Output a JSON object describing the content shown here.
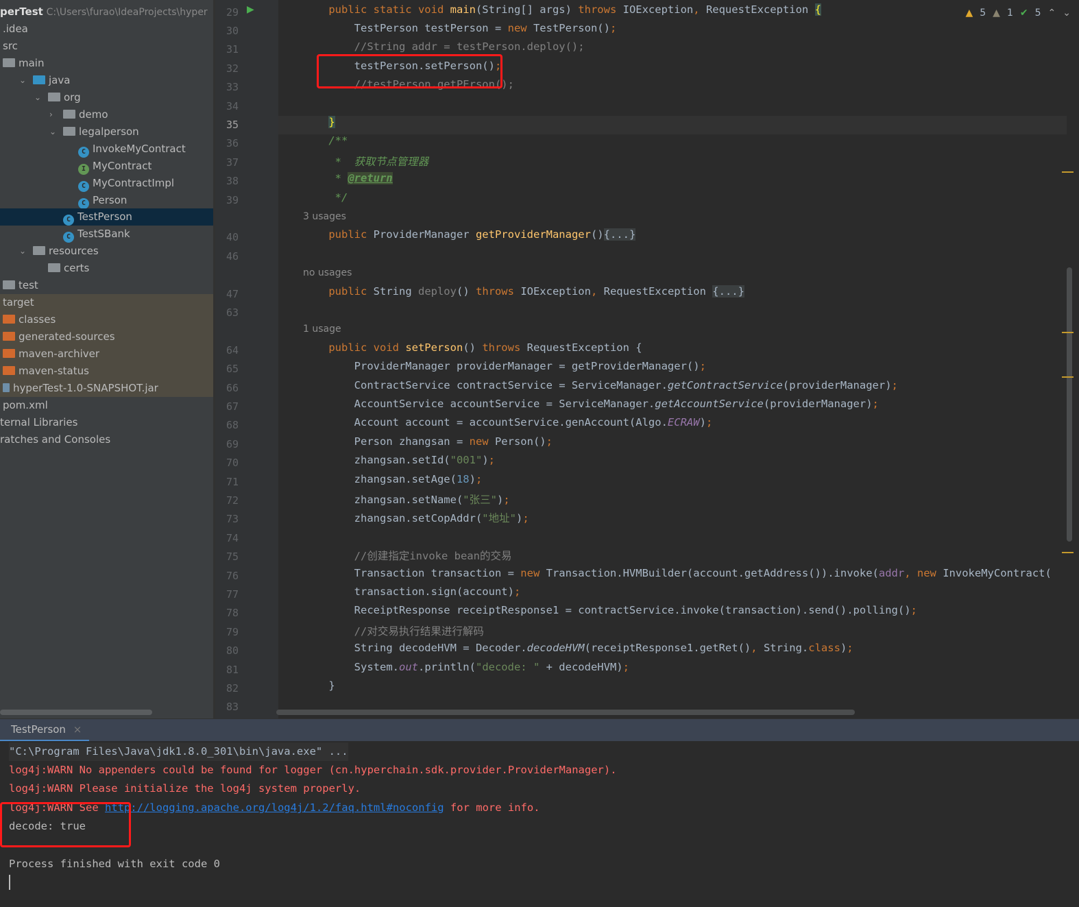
{
  "colors": {
    "keyword": "#cc7832",
    "method": "#ffc66d",
    "comment": "#808080",
    "doc": "#629755",
    "string": "#6a8759",
    "number": "#6897bb",
    "static": "#9876aa",
    "error": "#ff6b68",
    "link": "#287bde",
    "highlight_box": "#ff1a1a"
  },
  "sidebar": {
    "project_name": "perTest",
    "project_path": "C:\\Users\\furao\\IdeaProjects\\hyper",
    "items": [
      {
        "label": ".idea",
        "indent": 0,
        "icon": "none"
      },
      {
        "label": "src",
        "indent": 0,
        "icon": "none"
      },
      {
        "label": "main",
        "indent": 0,
        "icon": "folder"
      },
      {
        "label": "java",
        "indent": 1,
        "icon": "source-folder",
        "expanded": true
      },
      {
        "label": "org",
        "indent": 2,
        "icon": "package",
        "expanded": true
      },
      {
        "label": "demo",
        "indent": 3,
        "icon": "package",
        "expanded": false
      },
      {
        "label": "legalperson",
        "indent": 3,
        "icon": "package",
        "expanded": true
      },
      {
        "label": "InvokeMyContract",
        "indent": 4,
        "icon": "class"
      },
      {
        "label": "MyContract",
        "indent": 4,
        "icon": "interface"
      },
      {
        "label": "MyContractImpl",
        "indent": 4,
        "icon": "class"
      },
      {
        "label": "Person",
        "indent": 4,
        "icon": "class"
      },
      {
        "label": "TestPerson",
        "indent": 3,
        "icon": "runnable-class",
        "selected": true
      },
      {
        "label": "TestSBank",
        "indent": 3,
        "icon": "runnable-class"
      },
      {
        "label": "resources",
        "indent": 1,
        "icon": "resources-folder",
        "expanded": true
      },
      {
        "label": "certs",
        "indent": 2,
        "icon": "folder"
      },
      {
        "label": "test",
        "indent": 0,
        "icon": "folder"
      },
      {
        "label": "target",
        "indent": 0,
        "icon": "none",
        "excluded": true
      },
      {
        "label": "classes",
        "indent": 0,
        "icon": "excluded-folder",
        "excluded": true
      },
      {
        "label": "generated-sources",
        "indent": 0,
        "icon": "excluded-folder",
        "excluded": true
      },
      {
        "label": "maven-archiver",
        "indent": 0,
        "icon": "excluded-folder",
        "excluded": true
      },
      {
        "label": "maven-status",
        "indent": 0,
        "icon": "excluded-folder",
        "excluded": true
      },
      {
        "label": "hyperTest-1.0-SNAPSHOT.jar",
        "indent": 0,
        "icon": "jar",
        "excluded": true
      },
      {
        "label": "pom.xml",
        "indent": 0,
        "icon": "none"
      },
      {
        "label": "ternal Libraries",
        "indent": -1,
        "icon": "none"
      },
      {
        "label": "ratches and Consoles",
        "indent": -1,
        "icon": "none"
      }
    ]
  },
  "inspections": {
    "warnings": "5",
    "weak_warnings": "1",
    "ok": "5"
  },
  "editor": {
    "lines": [
      {
        "n": "29",
        "t": [
          [
            "    public static void ",
            "kw"
          ],
          [
            "main",
            "fn"
          ],
          [
            "(String[] args) ",
            ""
          ],
          [
            "throws ",
            "kw"
          ],
          [
            "IOException",
            ""
          ],
          [
            ", ",
            "kw"
          ],
          [
            "RequestException ",
            ""
          ],
          [
            "{",
            "br"
          ]
        ]
      },
      {
        "n": "30",
        "t": [
          [
            "        TestPerson testPerson = ",
            ""
          ],
          [
            "new ",
            "kw"
          ],
          [
            "TestPerson()",
            ""
          ],
          [
            ";",
            "kw"
          ]
        ]
      },
      {
        "n": "31",
        "t": [
          [
            "        //String addr = testPerson.deploy();",
            "cm"
          ]
        ]
      },
      {
        "n": "32",
        "t": [
          [
            "        testPerson.setPerson()",
            ""
          ],
          [
            ";",
            "kw"
          ]
        ]
      },
      {
        "n": "33",
        "t": [
          [
            "        //testPerson.getPErson();",
            "cm"
          ]
        ]
      },
      {
        "n": "34",
        "t": []
      },
      {
        "n": "35",
        "cur": true,
        "t": [
          [
            "    ",
            ""
          ],
          [
            "}",
            "br"
          ]
        ]
      },
      {
        "n": "36",
        "t": [
          [
            "    /**",
            "doc"
          ]
        ]
      },
      {
        "n": "37",
        "t": [
          [
            "     *  获取节点管理器",
            "doc"
          ]
        ]
      },
      {
        "n": "38",
        "t": [
          [
            "     * ",
            "doc"
          ],
          [
            "@return",
            "tag"
          ]
        ]
      },
      {
        "n": "39",
        "t": [
          [
            "     */",
            "doc"
          ]
        ]
      },
      {
        "hint": "3 usages"
      },
      {
        "n": "40",
        "t": [
          [
            "    public ",
            "kw"
          ],
          [
            "ProviderManager ",
            ""
          ],
          [
            "getProviderManager",
            "fn"
          ],
          [
            "()",
            ""
          ],
          [
            "{...}",
            "fold"
          ]
        ]
      },
      {
        "n": "46",
        "t": []
      },
      {
        "hint": "no usages"
      },
      {
        "n": "47",
        "t": [
          [
            "    public ",
            "kw"
          ],
          [
            "String ",
            ""
          ],
          [
            "deploy",
            "cm"
          ],
          [
            "() ",
            ""
          ],
          [
            "throws ",
            "kw"
          ],
          [
            "IOException",
            ""
          ],
          [
            ", ",
            "kw"
          ],
          [
            "RequestException ",
            ""
          ],
          [
            "{...}",
            "fold"
          ]
        ]
      },
      {
        "n": "63",
        "t": []
      },
      {
        "hint": "1 usage"
      },
      {
        "n": "64",
        "t": [
          [
            "    public void ",
            "kw"
          ],
          [
            "setPerson",
            "fn"
          ],
          [
            "() ",
            ""
          ],
          [
            "throws ",
            "kw"
          ],
          [
            "RequestException {",
            ""
          ]
        ]
      },
      {
        "n": "65",
        "t": [
          [
            "        ProviderManager providerManager = getProviderManager()",
            ""
          ],
          [
            ";",
            "kw"
          ]
        ]
      },
      {
        "n": "66",
        "t": [
          [
            "        ContractService contractService = ServiceManager.",
            ""
          ],
          [
            "getContractService",
            "it"
          ],
          [
            "(providerManager)",
            ""
          ],
          [
            ";",
            "kw"
          ]
        ]
      },
      {
        "n": "67",
        "t": [
          [
            "        AccountService accountService = ServiceManager.",
            ""
          ],
          [
            "getAccountService",
            "it"
          ],
          [
            "(providerManager)",
            ""
          ],
          [
            ";",
            "kw"
          ]
        ]
      },
      {
        "n": "68",
        "t": [
          [
            "        Account account = accountService.genAccount(Algo.",
            ""
          ],
          [
            "ECRAW",
            "st"
          ],
          [
            ")",
            ""
          ],
          [
            ";",
            "kw"
          ]
        ]
      },
      {
        "n": "69",
        "t": [
          [
            "        Person zhangsan = ",
            ""
          ],
          [
            "new ",
            "kw"
          ],
          [
            "Person()",
            ""
          ],
          [
            ";",
            "kw"
          ]
        ]
      },
      {
        "n": "70",
        "t": [
          [
            "        zhangsan.setId(",
            ""
          ],
          [
            "\"001\"",
            "str"
          ],
          [
            ")",
            ""
          ],
          [
            ";",
            "kw"
          ]
        ]
      },
      {
        "n": "71",
        "t": [
          [
            "        zhangsan.setAge(",
            ""
          ],
          [
            "18",
            "num"
          ],
          [
            ")",
            ""
          ],
          [
            ";",
            "kw"
          ]
        ]
      },
      {
        "n": "72",
        "t": [
          [
            "        zhangsan.setName(",
            ""
          ],
          [
            "\"张三\"",
            "str"
          ],
          [
            ")",
            ""
          ],
          [
            ";",
            "kw"
          ]
        ]
      },
      {
        "n": "73",
        "t": [
          [
            "        zhangsan.setCopAddr(",
            ""
          ],
          [
            "\"地址\"",
            "str"
          ],
          [
            ")",
            ""
          ],
          [
            ";",
            "kw"
          ]
        ]
      },
      {
        "n": "74",
        "t": []
      },
      {
        "n": "75",
        "t": [
          [
            "        //创建指定invoke bean的交易",
            "cm"
          ]
        ]
      },
      {
        "n": "76",
        "t": [
          [
            "        Transaction transaction = ",
            ""
          ],
          [
            "new ",
            "kw"
          ],
          [
            "Transaction.HVMBuilder(account.getAddress()).invoke(",
            ""
          ],
          [
            "addr",
            "par"
          ],
          [
            ", ",
            "kw"
          ],
          [
            "new ",
            "kw"
          ],
          [
            "InvokeMyContract(",
            ""
          ]
        ]
      },
      {
        "n": "77",
        "t": [
          [
            "        transaction.sign(account)",
            ""
          ],
          [
            ";",
            "kw"
          ]
        ]
      },
      {
        "n": "78",
        "t": [
          [
            "        ReceiptResponse receiptResponse1 = contractService.invoke(transaction).send().polling()",
            ""
          ],
          [
            ";",
            "kw"
          ]
        ]
      },
      {
        "n": "79",
        "t": [
          [
            "        //对交易执行结果进行解码",
            "cm"
          ]
        ]
      },
      {
        "n": "80",
        "t": [
          [
            "        String decodeHVM = Decoder.",
            ""
          ],
          [
            "decodeHVM",
            "it"
          ],
          [
            "(receiptResponse1.getRet()",
            ""
          ],
          [
            ", ",
            "kw"
          ],
          [
            "String.",
            ""
          ],
          [
            "class",
            "kw"
          ],
          [
            ")",
            ""
          ],
          [
            ";",
            "kw"
          ]
        ]
      },
      {
        "n": "81",
        "t": [
          [
            "        System.",
            ""
          ],
          [
            "out",
            "st"
          ],
          [
            ".println(",
            ""
          ],
          [
            "\"decode: \" ",
            "str"
          ],
          [
            "+ decodeHVM)",
            ""
          ],
          [
            ";",
            "kw"
          ]
        ]
      },
      {
        "n": "82",
        "t": [
          [
            "    }",
            ""
          ]
        ]
      },
      {
        "n": "83",
        "t": []
      }
    ]
  },
  "console": {
    "tab_label": "TestPerson",
    "cmd": "\"C:\\Program Files\\Java\\jdk1.8.0_301\\bin\\java.exe\" ...",
    "warn1": "log4j:WARN No appenders could be found for logger (cn.hyperchain.sdk.provider.ProviderManager).",
    "warn2": "log4j:WARN Please initialize the log4j system properly.",
    "warn3_prefix": "log4j:WARN See ",
    "warn3_link": "http://logging.apache.org/log4j/1.2/faq.html#noconfig",
    "warn3_suffix": " for more info.",
    "output": "decode: true",
    "exit": "Process finished with exit code 0"
  }
}
